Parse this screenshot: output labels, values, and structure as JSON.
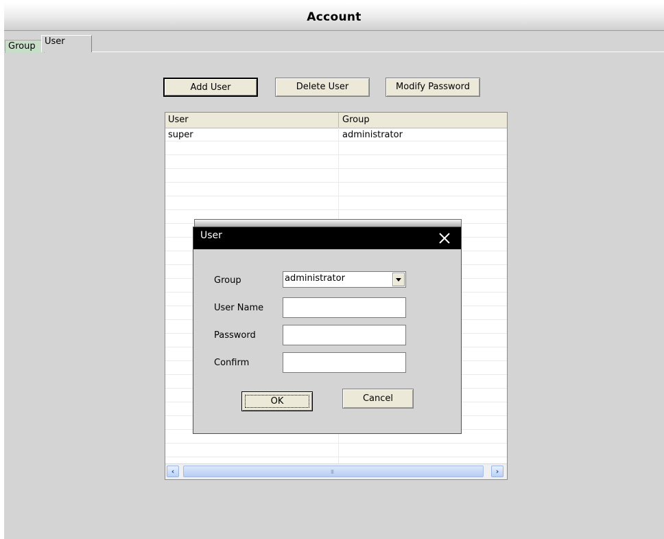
{
  "window": {
    "title": "Account"
  },
  "tabs": [
    {
      "label": "Group"
    },
    {
      "label": "User"
    }
  ],
  "toolbar": {
    "add_user": "Add User",
    "delete_user": "Delete User",
    "modify_password": "Modify Password"
  },
  "table": {
    "columns": [
      "User",
      "Group"
    ],
    "rows": [
      {
        "user": "super",
        "group": "administrator"
      }
    ],
    "scroll_grip": "III"
  },
  "dialog": {
    "title": "User",
    "group_label": "Group",
    "group_value": "administrator",
    "username_label": "User Name",
    "username_value": "",
    "password_label": "Password",
    "password_value": "",
    "confirm_label": "Confirm",
    "confirm_value": "",
    "ok": "OK",
    "cancel": "Cancel"
  },
  "icons": [
    "close-icon",
    "dropdown-arrow-icon",
    "scroll-left-icon",
    "scroll-right-icon"
  ]
}
